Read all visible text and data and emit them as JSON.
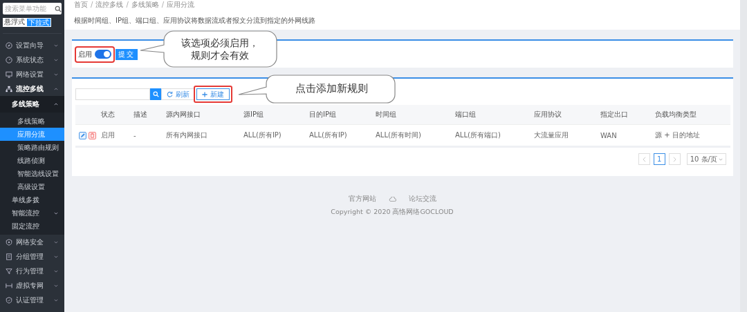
{
  "sidebar": {
    "search": {
      "placeholder": "搜索菜单功能"
    },
    "mode_tabs": [
      {
        "label": "悬浮式",
        "selected": false
      },
      {
        "label": "下拉式",
        "selected": true
      }
    ],
    "menu": [
      {
        "label": "设置向导",
        "expanded": false
      },
      {
        "label": "系统状态",
        "expanded": false
      },
      {
        "label": "网络设置",
        "expanded": false
      },
      {
        "label": "流控多线",
        "expanded": true,
        "children": [
          {
            "label": "多线策略",
            "expanded": true,
            "children": [
              {
                "label": "多线策略",
                "selected": false
              },
              {
                "label": "应用分流",
                "selected": true
              },
              {
                "label": "策略路由规则",
                "selected": false
              },
              {
                "label": "线路侦测",
                "selected": false
              },
              {
                "label": "智能选线设置",
                "selected": false
              },
              {
                "label": "高级设置",
                "selected": false
              }
            ]
          },
          {
            "label": "单线多拨"
          },
          {
            "label": "智能流控",
            "expanded": false
          },
          {
            "label": "固定流控"
          }
        ]
      },
      {
        "label": "网络安全",
        "expanded": false
      },
      {
        "label": "分组管理",
        "expanded": false
      },
      {
        "label": "行为管理",
        "expanded": false
      },
      {
        "label": "虚拟专网",
        "expanded": false
      },
      {
        "label": "认证管理",
        "expanded": false
      }
    ]
  },
  "breadcrumb": [
    {
      "label": "首页"
    },
    {
      "separator": "/",
      "label": "流控多线"
    },
    {
      "separator": "/",
      "label": "多线策略"
    },
    {
      "separator": "/",
      "label": "应用分流"
    }
  ],
  "description": "根据时间组、IP组、端口组、应用协议将数据流或者报文分流到指定的外网线路",
  "enable_panel": {
    "label": "启用",
    "on": true,
    "highlighted": true,
    "submit": "提交"
  },
  "toolbar": {
    "refresh": "刷新",
    "new": "新建",
    "new_highlighted": true
  },
  "table": {
    "columns": [
      "状态",
      "描述",
      "源内网接口",
      "源IP组",
      "目的IP组",
      "时间组",
      "端口组",
      "应用协议",
      "指定出口",
      "负载均衡类型"
    ],
    "rows": [
      [
        "启用",
        "-",
        "所有内网接口",
        "ALL(所有IP)",
        "ALL(所有IP)",
        "ALL(所有时间)",
        "ALL(所有端口)",
        "大流量应用",
        "WAN",
        "源 + 目的地址"
      ]
    ]
  },
  "pagination": {
    "pages": [
      {
        "label": "1",
        "selected": true
      }
    ],
    "page_size": "10 条/页"
  },
  "footer": {
    "links": [
      "官方网站",
      "论坛交流"
    ],
    "copyright": "Copyright © 2020 高恪网络GOCLOUD"
  },
  "annotations": [
    {
      "text": "该选项必须启用，规则才会有效"
    },
    {
      "text": "点击添加新规则"
    }
  ]
}
